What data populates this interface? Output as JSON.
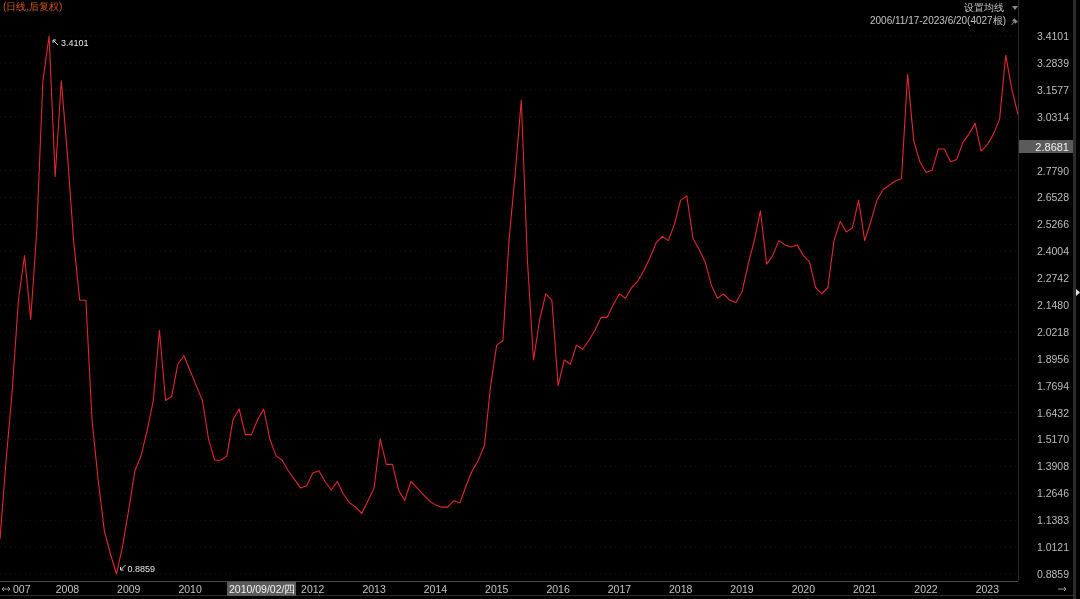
{
  "header": {
    "title": "(日线,后复权)",
    "ma_setting": "设置均线",
    "date_range": "2006/11/17-2023/6/20(4027根)"
  },
  "chart": {
    "x_axis_partial_label": "007",
    "crosshair": {
      "price": "2.8681",
      "date": "2010/09/02/四"
    },
    "chart_data": {
      "type": "line",
      "grid": true,
      "xlim": [
        2006.9,
        2023.5
      ],
      "ylim": [
        0.8531,
        3.579
      ],
      "x": [
        2006.9,
        2007,
        2007.1,
        2007.2,
        2007.3,
        2007.4,
        2007.5,
        2007.6,
        2007.7,
        2007.8,
        2007.9,
        2008,
        2008.1,
        2008.2,
        2008.3,
        2008.4,
        2008.5,
        2008.6,
        2008.7,
        2008.8,
        2008.9,
        2009,
        2009.1,
        2009.2,
        2009.3,
        2009.4,
        2009.5,
        2009.6,
        2009.7,
        2009.8,
        2009.9,
        2010,
        2010.1,
        2010.2,
        2010.3,
        2010.4,
        2010.5,
        2010.6,
        2010.7,
        2010.8,
        2010.9,
        2011,
        2011.1,
        2011.2,
        2011.3,
        2011.4,
        2011.5,
        2011.6,
        2011.7,
        2011.8,
        2011.9,
        2012,
        2012.1,
        2012.2,
        2012.3,
        2012.4,
        2012.5,
        2012.6,
        2012.7,
        2012.8,
        2012.9,
        2013,
        2013.1,
        2013.2,
        2013.3,
        2013.4,
        2013.5,
        2013.6,
        2013.7,
        2013.8,
        2013.9,
        2014,
        2014.1,
        2014.2,
        2014.3,
        2014.4,
        2014.5,
        2014.6,
        2014.7,
        2014.8,
        2014.9,
        2015,
        2015.1,
        2015.2,
        2015.3,
        2015.4,
        2015.5,
        2015.6,
        2015.7,
        2015.8,
        2015.9,
        2016,
        2016.1,
        2016.2,
        2016.3,
        2016.4,
        2016.5,
        2016.6,
        2016.7,
        2016.8,
        2016.9,
        2017,
        2017.1,
        2017.2,
        2017.3,
        2017.4,
        2017.5,
        2017.6,
        2017.7,
        2017.8,
        2017.9,
        2018,
        2018.1,
        2018.2,
        2018.3,
        2018.4,
        2018.5,
        2018.6,
        2018.7,
        2018.8,
        2018.9,
        2019,
        2019.1,
        2019.2,
        2019.3,
        2019.4,
        2019.5,
        2019.6,
        2019.7,
        2019.8,
        2019.9,
        2020,
        2020.1,
        2020.2,
        2020.3,
        2020.4,
        2020.5,
        2020.6,
        2020.7,
        2020.8,
        2020.9,
        2021,
        2021.1,
        2021.2,
        2021.3,
        2021.4,
        2021.5,
        2021.6,
        2021.7,
        2021.8,
        2021.9,
        2022,
        2022.1,
        2022.2,
        2022.3,
        2022.4,
        2022.5,
        2022.6,
        2022.7,
        2022.8,
        2022.9,
        2023,
        2023.1,
        2023.2,
        2023.3,
        2023.4,
        2023.5
      ],
      "series": [
        {
          "color": "#e3262f",
          "values": [
            1.05,
            1.42,
            1.75,
            2.17,
            2.38,
            2.08,
            2.5,
            3.2,
            3.4101,
            2.75,
            3.2,
            2.85,
            2.45,
            2.17,
            2.17,
            1.61,
            1.33,
            1.09,
            0.98,
            0.8859,
            1.02,
            1.19,
            1.37,
            1.44,
            1.56,
            1.7,
            2.03,
            1.7,
            1.72,
            1.87,
            1.91,
            1.84,
            1.77,
            1.7,
            1.52,
            1.42,
            1.42,
            1.44,
            1.61,
            1.66,
            1.54,
            1.54,
            1.61,
            1.66,
            1.52,
            1.44,
            1.42,
            1.37,
            1.33,
            1.29,
            1.3,
            1.36,
            1.37,
            1.32,
            1.28,
            1.32,
            1.26,
            1.22,
            1.2,
            1.17,
            1.23,
            1.29,
            1.52,
            1.4,
            1.4,
            1.28,
            1.23,
            1.32,
            1.29,
            1.26,
            1.23,
            1.21,
            1.2,
            1.2,
            1.23,
            1.22,
            1.3,
            1.37,
            1.42,
            1.49,
            1.77,
            1.96,
            1.98,
            2.45,
            2.76,
            3.11,
            2.36,
            1.89,
            2.08,
            2.2,
            2.17,
            1.77,
            1.89,
            1.87,
            1.96,
            1.94,
            1.98,
            2.03,
            2.09,
            2.09,
            2.15,
            2.2,
            2.18,
            2.23,
            2.26,
            2.31,
            2.37,
            2.44,
            2.47,
            2.45,
            2.53,
            2.64,
            2.66,
            2.46,
            2.41,
            2.35,
            2.24,
            2.18,
            2.2,
            2.17,
            2.16,
            2.21,
            2.34,
            2.45,
            2.59,
            2.34,
            2.38,
            2.45,
            2.43,
            2.42,
            2.43,
            2.38,
            2.35,
            2.23,
            2.2,
            2.23,
            2.45,
            2.54,
            2.49,
            2.51,
            2.64,
            2.45,
            2.54,
            2.64,
            2.69,
            2.71,
            2.73,
            2.74,
            3.23,
            2.92,
            2.82,
            2.77,
            2.78,
            2.88,
            2.88,
            2.82,
            2.83,
            2.91,
            2.95,
            3.0,
            2.87,
            2.9,
            2.95,
            3.02,
            3.32,
            3.16,
            3.04
          ]
        }
      ],
      "xticks": [
        {
          "value": 2008,
          "label": "2008"
        },
        {
          "value": 2009,
          "label": "2009"
        },
        {
          "value": 2010,
          "label": "2010"
        },
        {
          "value": 2012,
          "label": "2012"
        },
        {
          "value": 2013,
          "label": "2013"
        },
        {
          "value": 2014,
          "label": "2014"
        },
        {
          "value": 2015,
          "label": "2015"
        },
        {
          "value": 2016,
          "label": "2016"
        },
        {
          "value": 2017,
          "label": "2017"
        },
        {
          "value": 2018,
          "label": "2018"
        },
        {
          "value": 2019,
          "label": "2019"
        },
        {
          "value": 2020,
          "label": "2020"
        },
        {
          "value": 2021,
          "label": "2021"
        },
        {
          "value": 2022,
          "label": "2022"
        },
        {
          "value": 2023,
          "label": "2023"
        }
      ],
      "yticks": [
        {
          "value": 3.4101,
          "label": "3.4101"
        },
        {
          "value": 3.2839,
          "label": "3.2839"
        },
        {
          "value": 3.1577,
          "label": "3.1577"
        },
        {
          "value": 3.0314,
          "label": "3.0314"
        },
        {
          "value": 2.779,
          "label": "2.7790"
        },
        {
          "value": 2.6528,
          "label": "2.6528"
        },
        {
          "value": 2.5266,
          "label": "2.5266"
        },
        {
          "value": 2.4004,
          "label": "2.4004"
        },
        {
          "value": 2.2742,
          "label": "2.2742"
        },
        {
          "value": 2.148,
          "label": "2.1480"
        },
        {
          "value": 2.0218,
          "label": "2.0218"
        },
        {
          "value": 1.8956,
          "label": "1.8956"
        },
        {
          "value": 1.7694,
          "label": "1.7694"
        },
        {
          "value": 1.6432,
          "label": "1.6432"
        },
        {
          "value": 1.517,
          "label": "1.5170"
        },
        {
          "value": 1.3908,
          "label": "1.3908"
        },
        {
          "value": 1.2646,
          "label": "1.2646"
        },
        {
          "value": 1.1383,
          "label": "1.1383"
        },
        {
          "value": 1.0121,
          "label": "1.0121"
        },
        {
          "value": 0.8859,
          "label": "0.8859"
        }
      ],
      "annotations": [
        {
          "text": "3.4101",
          "x": 2007.7,
          "y": 3.4101
        },
        {
          "text": "0.8859",
          "x": 2008.8,
          "y": 0.8859
        }
      ]
    }
  }
}
